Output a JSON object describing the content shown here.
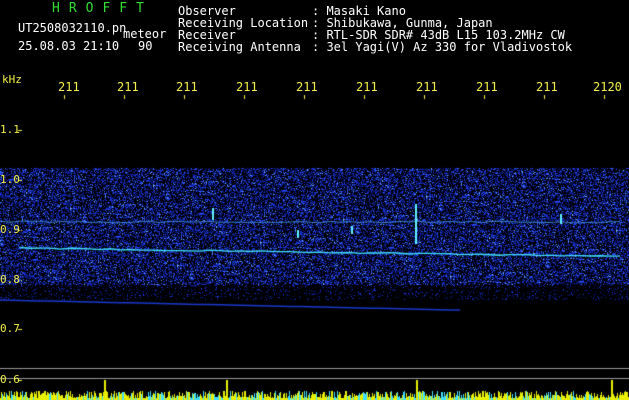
{
  "app": {
    "title": "HROFFT",
    "title_color": "#33dd33"
  },
  "file": {
    "name": "UT2508032110.pn",
    "mode": "meteor"
  },
  "time": {
    "stamp": "25.08.03 21:10",
    "value": "90"
  },
  "info": {
    "labels": [
      "Observer",
      "Receiving Location",
      "Receiver",
      "Receiving Antenna"
    ],
    "values": [
      ": Masaki Kano",
      ": Shibukawa, Gunma, Japan",
      ": RTL-SDR SDR# 43dB L15 103.2MHz CW",
      ": 3el Yagi(V) Az 330 for Vladivostok"
    ]
  },
  "axes": {
    "y_unit": "kHz",
    "y_ticks": [
      "1.1",
      "1.0",
      "0.9",
      "0.8",
      "0.7",
      "0.6"
    ],
    "x_ticks": [
      "211",
      "211",
      "211",
      "211",
      "211",
      "211",
      "211",
      "211",
      "211",
      "2120"
    ]
  },
  "colors": {
    "label_yellow": "#f5f048",
    "signal_blue": "#2040ff",
    "signal_cyan": "#40e0ff",
    "baseline_yellow": "#e8f000"
  }
}
